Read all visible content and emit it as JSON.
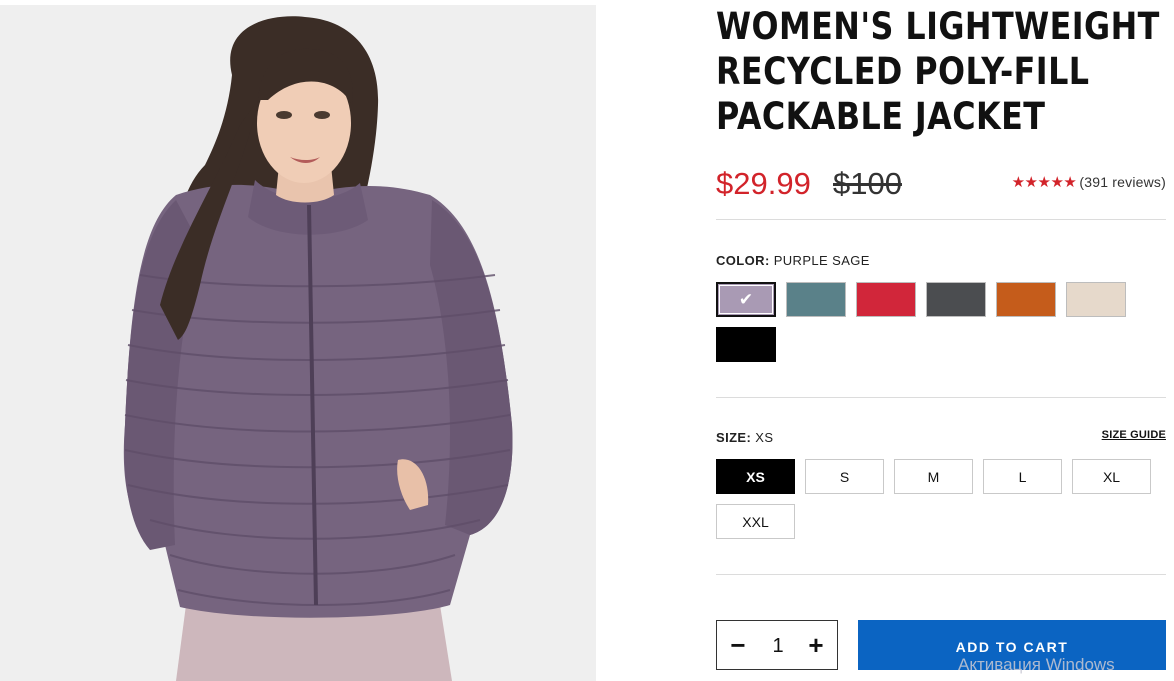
{
  "product": {
    "title_lines": [
      "WOMEN'S LIGHTWEIGHT",
      "RECYCLED POLY-FILL",
      "PACKABLE JACKET"
    ],
    "image_icon": "product-photo-woman-purple-puffer-jacket",
    "price": {
      "sale": "$29.99",
      "original": "$100",
      "sale_color": "#d2232a"
    },
    "rating": {
      "stars": "★★★★★",
      "stars_value": 5,
      "reviews": "(391 reviews)"
    }
  },
  "color": {
    "label": "COLOR:",
    "selected": "PURPLE SAGE",
    "swatches": [
      {
        "name": "purple-sage",
        "hex": "#a99ab4",
        "selected": true
      },
      {
        "name": "teal-slate",
        "hex": "#5a8189",
        "selected": false
      },
      {
        "name": "red",
        "hex": "#d1263a",
        "selected": false
      },
      {
        "name": "charcoal",
        "hex": "#4b4d50",
        "selected": false
      },
      {
        "name": "burnt-orange",
        "hex": "#c55c1b",
        "selected": false
      },
      {
        "name": "oat",
        "hex": "#e6d9cb",
        "selected": false
      },
      {
        "name": "black",
        "hex": "#000000",
        "selected": false
      }
    ],
    "check_icon": "check-icon"
  },
  "size": {
    "label": "SIZE:",
    "selected": "XS",
    "guide": "SIZE GUIDE",
    "options": [
      "XS",
      "S",
      "M",
      "L",
      "XL",
      "XXL"
    ]
  },
  "cart": {
    "quantity": "1",
    "minus": "−",
    "plus": "+",
    "add_label": "ADD TO CART",
    "button_color": "#0b64c2"
  },
  "system": {
    "watermark": "Активация Windows"
  }
}
